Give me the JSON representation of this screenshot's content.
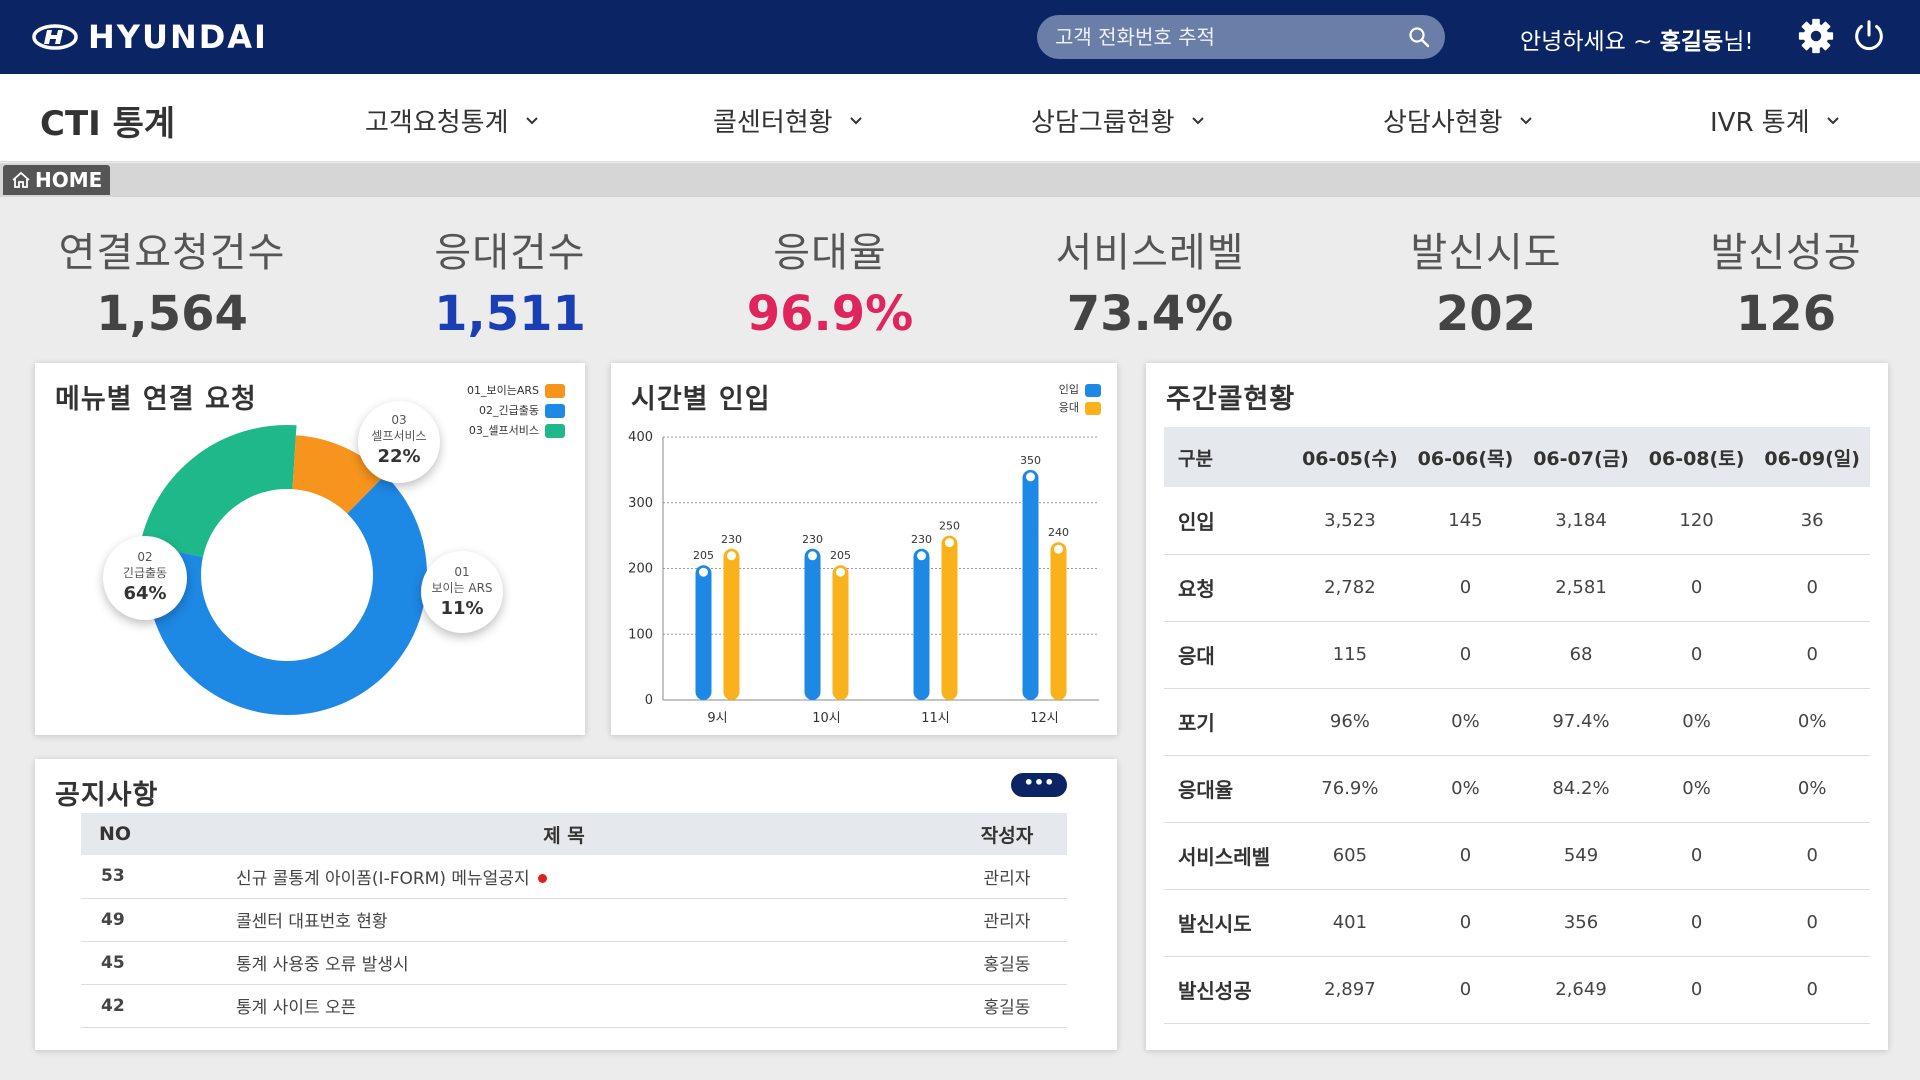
{
  "header": {
    "logo_text": "HYUNDAI",
    "search_placeholder": "고객 전화번호 추적",
    "greeting_prefix": "안녕하세요 ~ ",
    "user_name": "홍길동",
    "greeting_suffix": "님!",
    "icons": [
      "search-icon",
      "gear-icon",
      "power-icon"
    ]
  },
  "nav": {
    "title": "CTI 통계",
    "items": [
      "고객요청통계",
      "콜센터현황",
      "상담그룹현황",
      "상담사현황",
      "IVR 통계"
    ]
  },
  "breadcrumb": {
    "home": "HOME"
  },
  "kpis": [
    {
      "label": "연결요청건수",
      "value": "1,564",
      "color": "#444444"
    },
    {
      "label": "응대건수",
      "value": "1,511",
      "color": "#1a3fb4"
    },
    {
      "label": "응대율",
      "value": "96.9%",
      "color": "#e0245e"
    },
    {
      "label": "서비스레벨",
      "value": "73.4%",
      "color": "#444444"
    },
    {
      "label": "발신시도",
      "value": "202",
      "color": "#444444"
    },
    {
      "label": "발신성공",
      "value": "126",
      "color": "#444444"
    }
  ],
  "menu_card": {
    "title": "메뉴별 연결 요청",
    "legend": [
      "01_보이는ARS",
      "02_긴급출동",
      "03_셀프서비스"
    ],
    "bubbles": [
      {
        "num": "03",
        "name": "셀프서비스",
        "pct": "22%"
      },
      {
        "num": "02",
        "name": "긴급출동",
        "pct": "64%"
      },
      {
        "num": "01",
        "name": "보이는 ARS",
        "pct": "11%"
      }
    ]
  },
  "hourly_card": {
    "title": "시간별 인입",
    "legend": [
      "인입",
      "응대"
    ]
  },
  "weekly": {
    "title": "주간콜현황",
    "headers": [
      "구분",
      "06-05(수)",
      "06-06(목)",
      "06-07(금)",
      "06-08(토)",
      "06-09(일)"
    ],
    "rows": [
      [
        "인입",
        "3,523",
        "145",
        "3,184",
        "120",
        "36"
      ],
      [
        "요청",
        "2,782",
        "0",
        "2,581",
        "0",
        "0"
      ],
      [
        "응대",
        "115",
        "0",
        "68",
        "0",
        "0"
      ],
      [
        "포기",
        "96%",
        "0%",
        "97.4%",
        "0%",
        "0%"
      ],
      [
        "응대율",
        "76.9%",
        "0%",
        "84.2%",
        "0%",
        "0%"
      ],
      [
        "서비스레벨",
        "605",
        "0",
        "549",
        "0",
        "0"
      ],
      [
        "발신시도",
        "401",
        "0",
        "356",
        "0",
        "0"
      ],
      [
        "발신성공",
        "2,897",
        "0",
        "2,649",
        "0",
        "0"
      ]
    ]
  },
  "notice": {
    "title": "공지사항",
    "more_label": "•••",
    "headers": [
      "NO",
      "제 목",
      "작성자"
    ],
    "rows": [
      {
        "no": "53",
        "title": "신규 콜통계 아이폼(I-FORM) 메뉴얼공지",
        "author": "관리자",
        "new": true
      },
      {
        "no": "49",
        "title": "콜센터 대표번호 현황",
        "author": "관리자",
        "new": false
      },
      {
        "no": "45",
        "title": "통계 사용중 오류 발생시",
        "author": "홍길동",
        "new": false
      },
      {
        "no": "42",
        "title": "통계 사이트 오픈",
        "author": "홍길동",
        "new": false
      }
    ]
  },
  "chart_data": [
    {
      "type": "pie",
      "title": "메뉴별 연결 요청",
      "categories": [
        "01_보이는ARS",
        "02_긴급출동",
        "03_셀프서비스"
      ],
      "values": [
        11,
        64,
        22
      ],
      "colors": [
        "#f7941d",
        "#1e88e5",
        "#1fb88a"
      ],
      "donut": true
    },
    {
      "type": "bar",
      "title": "시간별 인입",
      "categories": [
        "9시",
        "10시",
        "11시",
        "12시"
      ],
      "series": [
        {
          "name": "인입",
          "values": [
            205,
            230,
            230,
            350
          ],
          "color": "#1e88e5"
        },
        {
          "name": "응대",
          "values": [
            230,
            205,
            250,
            240
          ],
          "color": "#f9b21b"
        }
      ],
      "ylim": [
        0,
        400
      ],
      "yticks": [
        0,
        100,
        200,
        300,
        400
      ],
      "grid": true,
      "legend": "top-right"
    }
  ]
}
